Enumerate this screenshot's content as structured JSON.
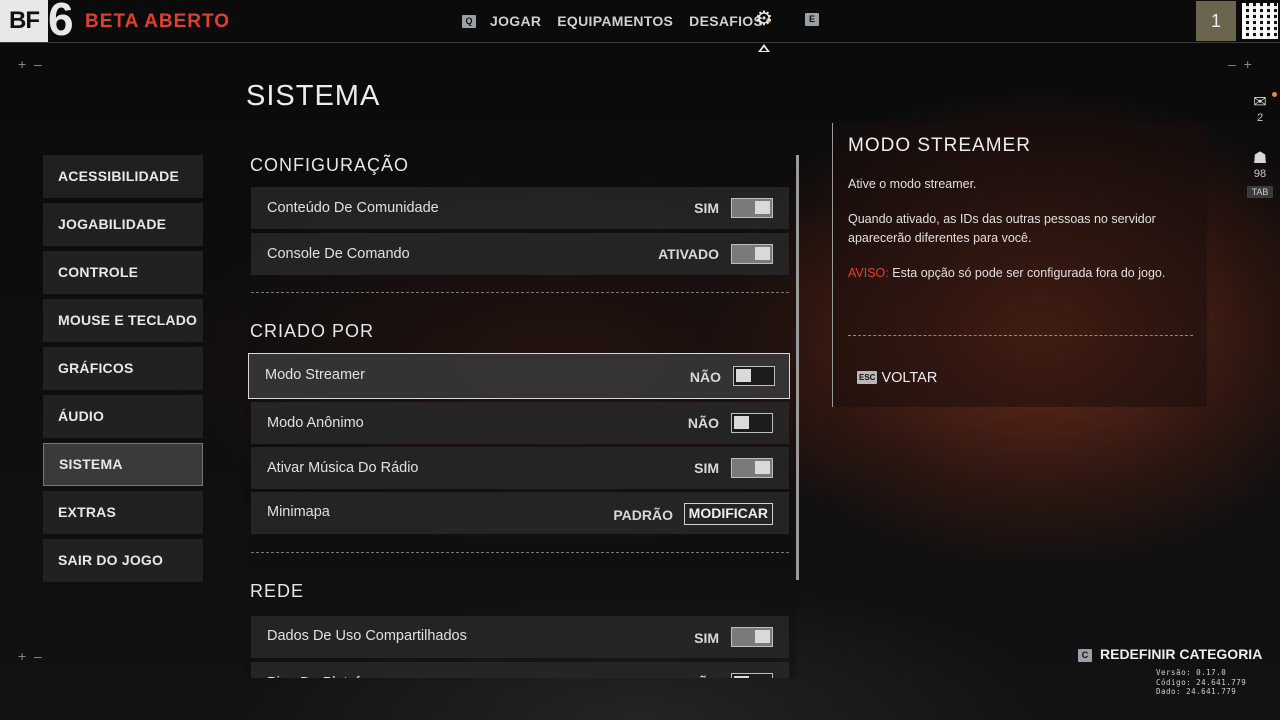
{
  "header": {
    "logo_bf": "BF",
    "logo_num": "6",
    "title": "BETA ABERTO",
    "nav_left_key": "Q",
    "nav": [
      {
        "label": "JOGAR"
      },
      {
        "label": "EQUIPAMENTOS"
      },
      {
        "label": "DESAFIOS",
        "has_notification": true
      }
    ],
    "nav_right_key": "E",
    "level": "1"
  },
  "page": {
    "title": "SISTEMA"
  },
  "sidebar": {
    "items": [
      {
        "label": "ACESSIBILIDADE"
      },
      {
        "label": "JOGABILIDADE"
      },
      {
        "label": "CONTROLE"
      },
      {
        "label": "MOUSE E TECLADO"
      },
      {
        "label": "GRÁFICOS"
      },
      {
        "label": "ÁUDIO"
      },
      {
        "label": "SISTEMA",
        "active": true
      },
      {
        "label": "EXTRAS"
      },
      {
        "label": "SAIR DO JOGO"
      }
    ]
  },
  "settings": {
    "sections": [
      {
        "title": "CONFIGURAÇÃO",
        "rows": [
          {
            "label": "Conteúdo De Comunidade",
            "value": "SIM",
            "toggle": true
          },
          {
            "label": "Console De Comando",
            "value": "ATIVADO",
            "toggle": true
          }
        ]
      },
      {
        "title": "CRIADO POR",
        "rows": [
          {
            "label": "Modo Streamer",
            "value": "NÃO",
            "toggle": false,
            "selected": true
          },
          {
            "label": "Modo Anônimo",
            "value": "NÃO",
            "toggle": false
          },
          {
            "label": "Ativar Música Do Rádio",
            "value": "SIM",
            "toggle": true
          },
          {
            "label": "Minimapa",
            "value": "PADRÃO",
            "button": "MODIFICAR"
          }
        ]
      },
      {
        "title": "REDE",
        "rows": [
          {
            "label": "Dados De Uso Compartilhados",
            "value": "SIM",
            "toggle": true
          },
          {
            "label": "Ping Da Plataforma",
            "value": "NÃO",
            "toggle": false
          }
        ]
      }
    ]
  },
  "info": {
    "title": "MODO STREAMER",
    "line1": "Ative o modo streamer.",
    "line2": "Quando ativado, as IDs das outras pessoas no servidor aparecerão diferentes para você.",
    "warn_label": "AVISO:",
    "warn_text": " Esta opção só pode ser configurada fora do jogo.",
    "back_key": "ESC",
    "back_label": "VOLTAR"
  },
  "rail": {
    "mail_count": "2",
    "squad_count": "98",
    "tab_key": "TAB"
  },
  "footer": {
    "reset_key": "C",
    "reset_label": "REDEFINIR CATEGORIA",
    "version": "Versão: 0.17.0",
    "code": "Código: 24.641.779",
    "data": "Dado: 24.641.779"
  },
  "colors": {
    "accent_red": "#e0402a",
    "notification_orange": "#e8893a"
  }
}
